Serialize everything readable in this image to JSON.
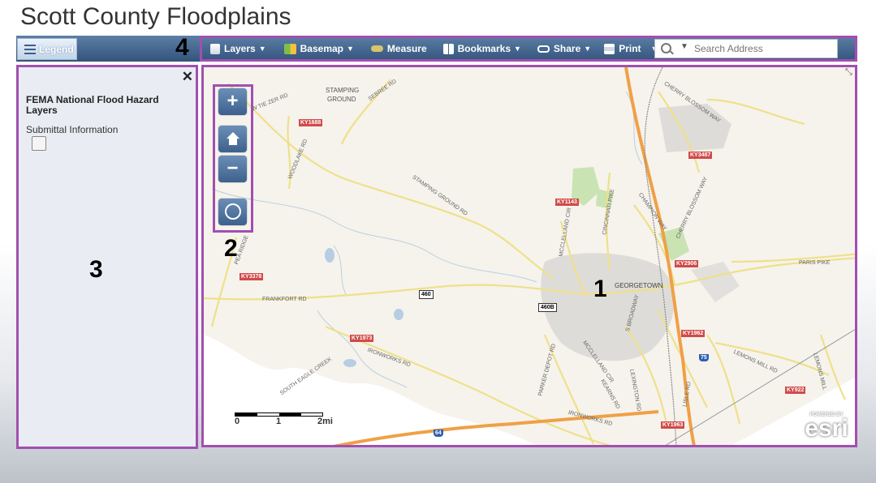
{
  "app": {
    "title": "Scott County Floodplains"
  },
  "legend_tab": {
    "label": "Legend"
  },
  "toolbar": {
    "items": [
      {
        "label": "Layers",
        "icon": "layers-icon",
        "has_caret": true
      },
      {
        "label": "Basemap",
        "icon": "basemap-icon",
        "has_caret": true
      },
      {
        "label": "Measure",
        "icon": "measure-icon",
        "has_caret": false
      },
      {
        "label": "Bookmarks",
        "icon": "bookmarks-icon",
        "has_caret": true
      },
      {
        "label": "Share",
        "icon": "share-icon",
        "has_caret": true
      },
      {
        "label": "Print",
        "icon": "print-icon",
        "has_caret": true
      }
    ],
    "search_placeholder": "Search Address"
  },
  "legend_panel": {
    "close_symbol": "✕",
    "layer_title": "FEMA National Flood Hazard Layers",
    "sublayer": "Submittal Information"
  },
  "map": {
    "zoom_in": "+",
    "zoom_out": "−",
    "scale_labels": [
      "0",
      "1",
      "2mi"
    ],
    "powered_by": "POWERED BY",
    "attribution": "esri",
    "place_labels": [
      "STAMPING",
      "GROUND",
      "GEORGETOWN"
    ],
    "road_labels": [
      "W TIE ZER RD",
      "SEBREE RD",
      "WOODLAKE RD",
      "STAMPING GROUND RD",
      "CINCINNATI PIKE",
      "CHAMPION WAY",
      "CHERRY BLOSSOM WAY",
      "PARIS PIKE",
      "MCCLELLAND CIR",
      "FRANKFORT RD",
      "PEA RIDGE",
      "IRONWORKS RD",
      "S BROADWAY",
      "PARKER DEPOT RD",
      "KEARNS RD",
      "MCCLELLAND CIR",
      "LEMONS MILL RD",
      "LEMONS MILL",
      "SOUTH EAGLE CREEK",
      "LISLE RD",
      "LEXINGTON RD",
      "IRONWORKS RD",
      "CHERRY BLOSSOM WAY"
    ],
    "route_shields": [
      "KY1688",
      "KY3487",
      "KY1143",
      "KY2906",
      "KY3378",
      "460",
      "460B",
      "KY1973",
      "KY1962",
      "75",
      "KY922",
      "64",
      "KY1963"
    ]
  },
  "callouts": [
    "1",
    "2",
    "3",
    "4"
  ],
  "colors": {
    "accent_frame": "#a24fb0",
    "toolbar": "#3f6189",
    "panel": "#e9edf3"
  }
}
